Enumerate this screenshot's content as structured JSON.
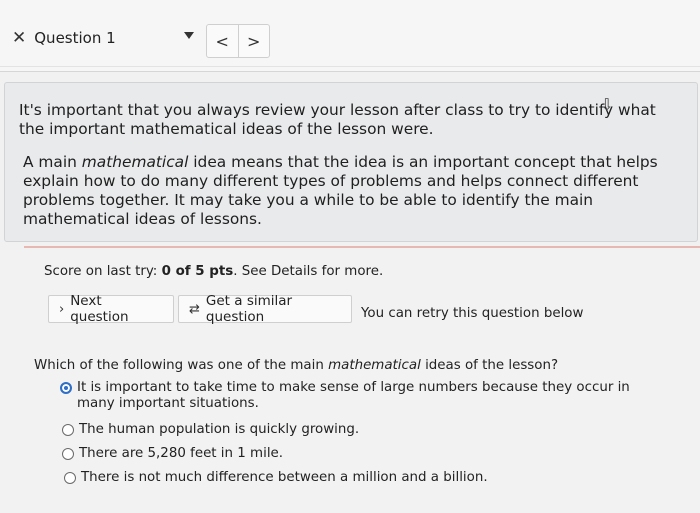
{
  "header": {
    "question_label": "Question 1",
    "prev_label": "<",
    "next_label": ">"
  },
  "intro": {
    "paragraph1": "It's important that you always review your lesson after class to try to identify what the important mathematical ideas of the lesson were.",
    "paragraph2_a": "A main ",
    "paragraph2_em": "mathematical",
    "paragraph2_b": " idea means that the idea is an important concept that helps explain how to do many different types of problems and helps connect different problems together. It may take you a while to be able to identify the main mathematical ideas of lessons."
  },
  "score": {
    "prefix": "Score on last try: ",
    "value": "0 of 5 pts",
    "suffix": ". See Details for more."
  },
  "buttons": {
    "next_question": "Next question",
    "similar_question": "Get a similar question",
    "retry_note": "You can retry this question below"
  },
  "question": {
    "text_a": "Which of the following was one of the main ",
    "text_em": "mathematical",
    "text_b": " ideas of the lesson?",
    "options": [
      {
        "label": "It is important to take time to make sense of large numbers because they occur in many important situations.",
        "selected": true
      },
      {
        "label": "The human population is quickly growing.",
        "selected": false
      },
      {
        "label": "There are 5,280 feet in 1 mile.",
        "selected": false
      },
      {
        "label": "There is not much difference between a million and a billion.",
        "selected": false
      }
    ]
  },
  "colors": {
    "accent": "#2e6fc7",
    "divider": "#e7b7b1"
  },
  "icons": {
    "close": "close-icon",
    "caret": "chevron-down-icon",
    "next": "chevron-right-icon",
    "similar": "refresh-icon"
  }
}
